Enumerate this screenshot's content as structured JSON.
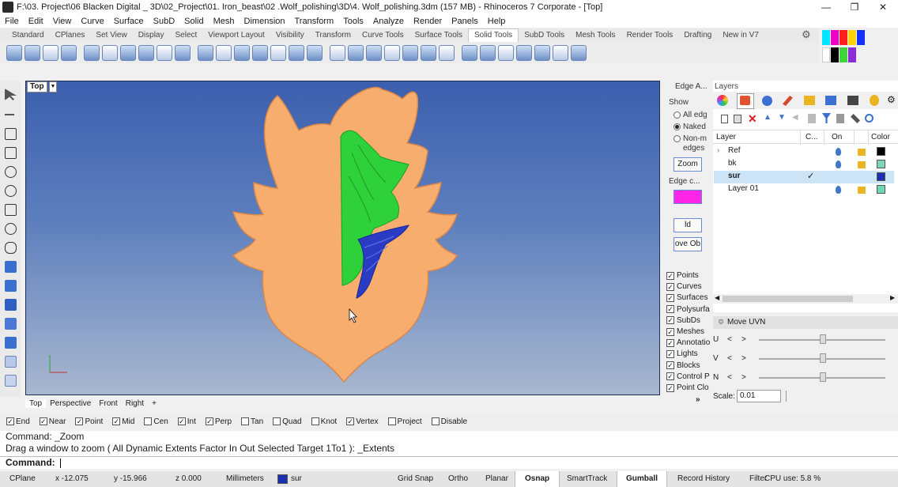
{
  "window": {
    "title": "F:\\03. Project\\06 Blacken Digital _ 3D\\02_Project\\01. Iron_beast\\02 .Wolf_polishing\\3D\\4. Wolf_polishing.3dm (157 MB) - Rhinoceros 7 Corporate - [Top]",
    "minimize": "—",
    "maximize": "❐",
    "close": "✕"
  },
  "menu": [
    "File",
    "Edit",
    "View",
    "Curve",
    "Surface",
    "SubD",
    "Solid",
    "Mesh",
    "Dimension",
    "Transform",
    "Tools",
    "Analyze",
    "Render",
    "Panels",
    "Help"
  ],
  "toolbar_tabs": [
    "Standard",
    "CPlanes",
    "Set View",
    "Display",
    "Select",
    "Viewport Layout",
    "Visibility",
    "Transform",
    "Curve Tools",
    "Surface Tools",
    "Solid Tools",
    "SubD Tools",
    "Mesh Tools",
    "Render Tools",
    "Drafting",
    "New in V7"
  ],
  "active_tab": "Solid Tools",
  "viewport": {
    "label": "Top",
    "tabs": [
      "Top",
      "Perspective",
      "Front",
      "Right"
    ],
    "add_tab": "+"
  },
  "edge_panel": {
    "title": "Edge A...",
    "show_label": "Show",
    "options": [
      "All edg",
      "Naked",
      "Non-m",
      "edges"
    ],
    "zoom_button": "Zoom",
    "edge_color_label": "Edge c...",
    "edge_color": "#ff26e8",
    "add_objects": "ld Objec",
    "remove_objects": "ove Ob"
  },
  "visibility": {
    "items": [
      "Points",
      "Curves",
      "Surfaces",
      "Polysurfa",
      "SubDs",
      "Meshes",
      "Annotatio",
      "Lights",
      "Blocks",
      "Control P",
      "Point Clo"
    ],
    "more": "»"
  },
  "layers": {
    "panel_title": "Layers",
    "columns": [
      "Layer",
      "C...",
      "On",
      "Color"
    ],
    "rows": [
      {
        "name": "Ref",
        "expand": "›",
        "color": "#000000",
        "current": false
      },
      {
        "name": "bk",
        "expand": "",
        "color": "#7fd6b7",
        "current": false
      },
      {
        "name": "sur",
        "expand": "",
        "color": "#1b2fb0",
        "current": true
      },
      {
        "name": "Layer 01",
        "expand": "",
        "color": "#6fd8ae",
        "current": false
      }
    ]
  },
  "uvn": {
    "title": "Move UVN",
    "labels": [
      "U",
      "V",
      "N"
    ],
    "left_arrow": "<",
    "right_arrow": ">",
    "scale_label": "Scale:",
    "scale_value": "0.01"
  },
  "osnap": {
    "items": [
      {
        "label": "End",
        "checked": true
      },
      {
        "label": "Near",
        "checked": true
      },
      {
        "label": "Point",
        "checked": true
      },
      {
        "label": "Mid",
        "checked": true
      },
      {
        "label": "Cen",
        "checked": false
      },
      {
        "label": "Int",
        "checked": true
      },
      {
        "label": "Perp",
        "checked": true
      },
      {
        "label": "Tan",
        "checked": false
      },
      {
        "label": "Quad",
        "checked": false
      },
      {
        "label": "Knot",
        "checked": false
      },
      {
        "label": "Vertex",
        "checked": true
      },
      {
        "label": "Project",
        "checked": false
      },
      {
        "label": "Disable",
        "checked": false
      }
    ]
  },
  "command": {
    "history1": "Command: _Zoom",
    "history2": "Drag a window to zoom ( All  Dynamic  Extents  Factor  In  Out  Selected  Target  1To1 ): _Extents",
    "prompt": "Command:"
  },
  "status": {
    "cplane": "CPlane",
    "x": "x -12.075",
    "y": "y -15.966",
    "z": "z 0.000",
    "units": "Millimeters",
    "layer": "sur",
    "layer_color": "#1b2fb0",
    "grid_snap": "Grid Snap",
    "ortho": "Ortho",
    "planar": "Planar",
    "osnap": "Osnap",
    "smarttrack": "SmartTrack",
    "gumball": "Gumball",
    "record_history": "Record History",
    "filter": "Filter",
    "cpu": "CPU use: 5.8 %"
  },
  "colors": {
    "wolf_fill": "#f6ad6e",
    "wolf_stroke": "#d9874a",
    "green_surface": "#2ed13a",
    "blue_surface": "#2a3bc4"
  }
}
